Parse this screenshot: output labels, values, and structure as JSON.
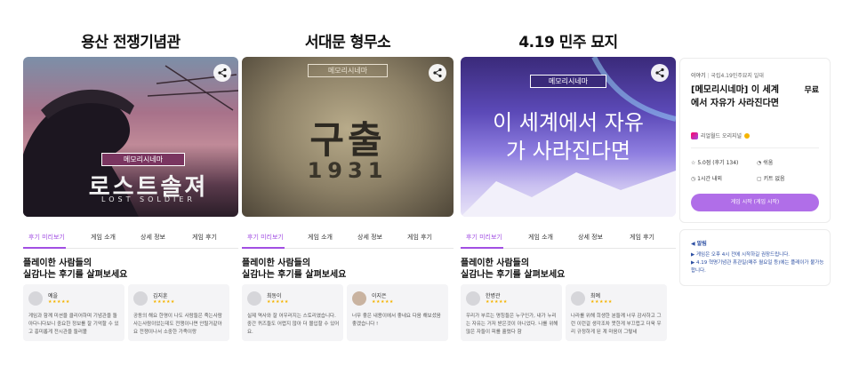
{
  "headings": [
    "용산 전쟁기념관",
    "서대문 형무소",
    "4.19 민주 묘지"
  ],
  "tabs": [
    "후기 미리보기",
    "게임 소개",
    "상세 정보",
    "게임 후기"
  ],
  "review_title": "플레이한 사람들의\n실감나는 후기를 살펴보세요",
  "panels": [
    {
      "poster": {
        "badge": "메모리시네마",
        "title": "로스트솔져",
        "subtitle": "LOST SOLDIER"
      },
      "reviews": [
        {
          "name": "예을",
          "stars": "★★★★★",
          "text": "게임과 함께 미션을 클리어하며 기념관을 돌아다니다보니 중요한 정보를 잘 기억할 수 있고 흥미롭게 전시관을 둘러볼"
        },
        {
          "name": "김지훈",
          "stars": "★★★★★",
          "text": "공동의 해요 한명이 나도 사람들은 죽는사람 사는사람이었는데도 전쟁이나면 안될거같아요 전쟁이나서 소중한 가족이랑"
        }
      ]
    },
    {
      "poster": {
        "badge": "메모리시네마",
        "title": "구출",
        "subtitle": "1931"
      },
      "reviews": [
        {
          "name": "최동이",
          "stars": "★★★★★",
          "text": "실제 역사와 잘 어우러지는 스토리였습니다. 중간 퀴즈들도 어렵지 않아 더 몰입할 수 있어요."
        },
        {
          "name": "이지은",
          "stars": "★★★★★",
          "text": "너무 좋은 내용이에서 좋네요 다음 해보셨음 좋겠습니다 !"
        }
      ]
    },
    {
      "poster": {
        "badge": "메모리시네마",
        "title": "이 세계에서 자유가 사라진다면"
      },
      "reviews": [
        {
          "name": "한병관",
          "stars": "★★★★★",
          "text": "우리가 부르는 명칭들은 누구인가, 내가 누리는 자유는 거저 받은것이 아니었다. 나를 위해 많은 자들이 피를 흘렸다 함"
        },
        {
          "name": "최예",
          "stars": "★★★★★",
          "text": "나라를 위해 희생한 분들께 너무 감사하고 그런 이런걸 생각조차 못한게 부끄럽고 더욱 우리 규정하게 된 계 마음이 그렇네"
        }
      ]
    }
  ],
  "info": {
    "category": "이야기",
    "location": "국립4.19민주묘지 일대",
    "title": "[메모리시네마] 이 세계에서 자유가 사라진다면",
    "price": "무료",
    "creator": "리얼월드 오리지널",
    "rating": "5.0점 (후기 134)",
    "difficulty": "쉬움",
    "duration": "1시간 내외",
    "kit": "키트 없음",
    "cta": "게임 시작 (게임 시작)",
    "accent_color": "#b06ee8"
  },
  "notice": {
    "label": "알림",
    "line1": "▶ 게임은 오후 4시 전에 시작하길 권장드립니다.",
    "line2": "▶ 4.19 혁명기념관 휴관일(매주 월요일 등)에는 플레이가 불가능합니다."
  },
  "icons": [
    "share-icon",
    "star-icon",
    "difficulty-icon",
    "clock-icon",
    "kit-icon",
    "verified-icon",
    "notice-icon"
  ]
}
